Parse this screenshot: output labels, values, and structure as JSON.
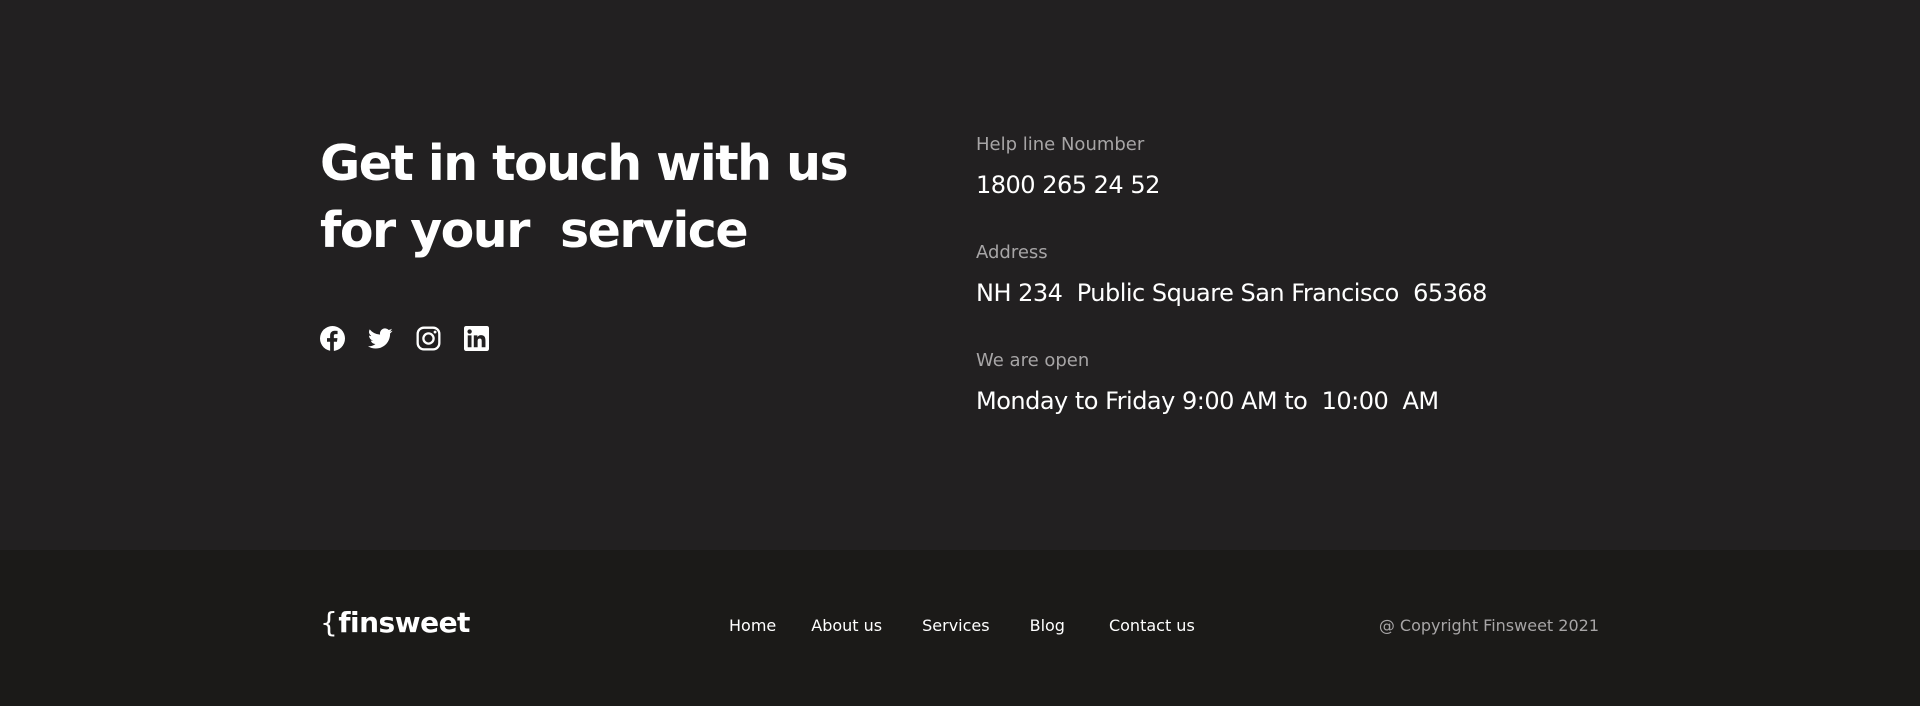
{
  "contact": {
    "headline_line1": "Get in touch with us",
    "headline_line2": "for your  service",
    "socials": [
      {
        "name": "facebook-icon"
      },
      {
        "name": "twitter-icon"
      },
      {
        "name": "instagram-icon"
      },
      {
        "name": "linkedin-icon"
      }
    ],
    "info": {
      "helpline_label": "Help line Noumber",
      "helpline_value": "1800 265 24 52",
      "address_label": "Address",
      "address_value": "NH 234  Public Square San Francisco  65368",
      "hours_label": "We are open",
      "hours_value": "Monday to Friday 9:00 AM to  10:00  AM"
    }
  },
  "footer": {
    "brand_brace": "{",
    "brand_name": "finsweet",
    "nav": {
      "home": "Home",
      "about": "About us",
      "services": "Services",
      "blog": "Blog",
      "contact": "Contact us"
    },
    "copyright": "@ Copyright Finsweet 2021"
  },
  "colors": {
    "contact_background": "#222021",
    "footer_background": "#1b1a18",
    "text_primary": "#ffffff",
    "text_muted": "#a7a5a6"
  }
}
